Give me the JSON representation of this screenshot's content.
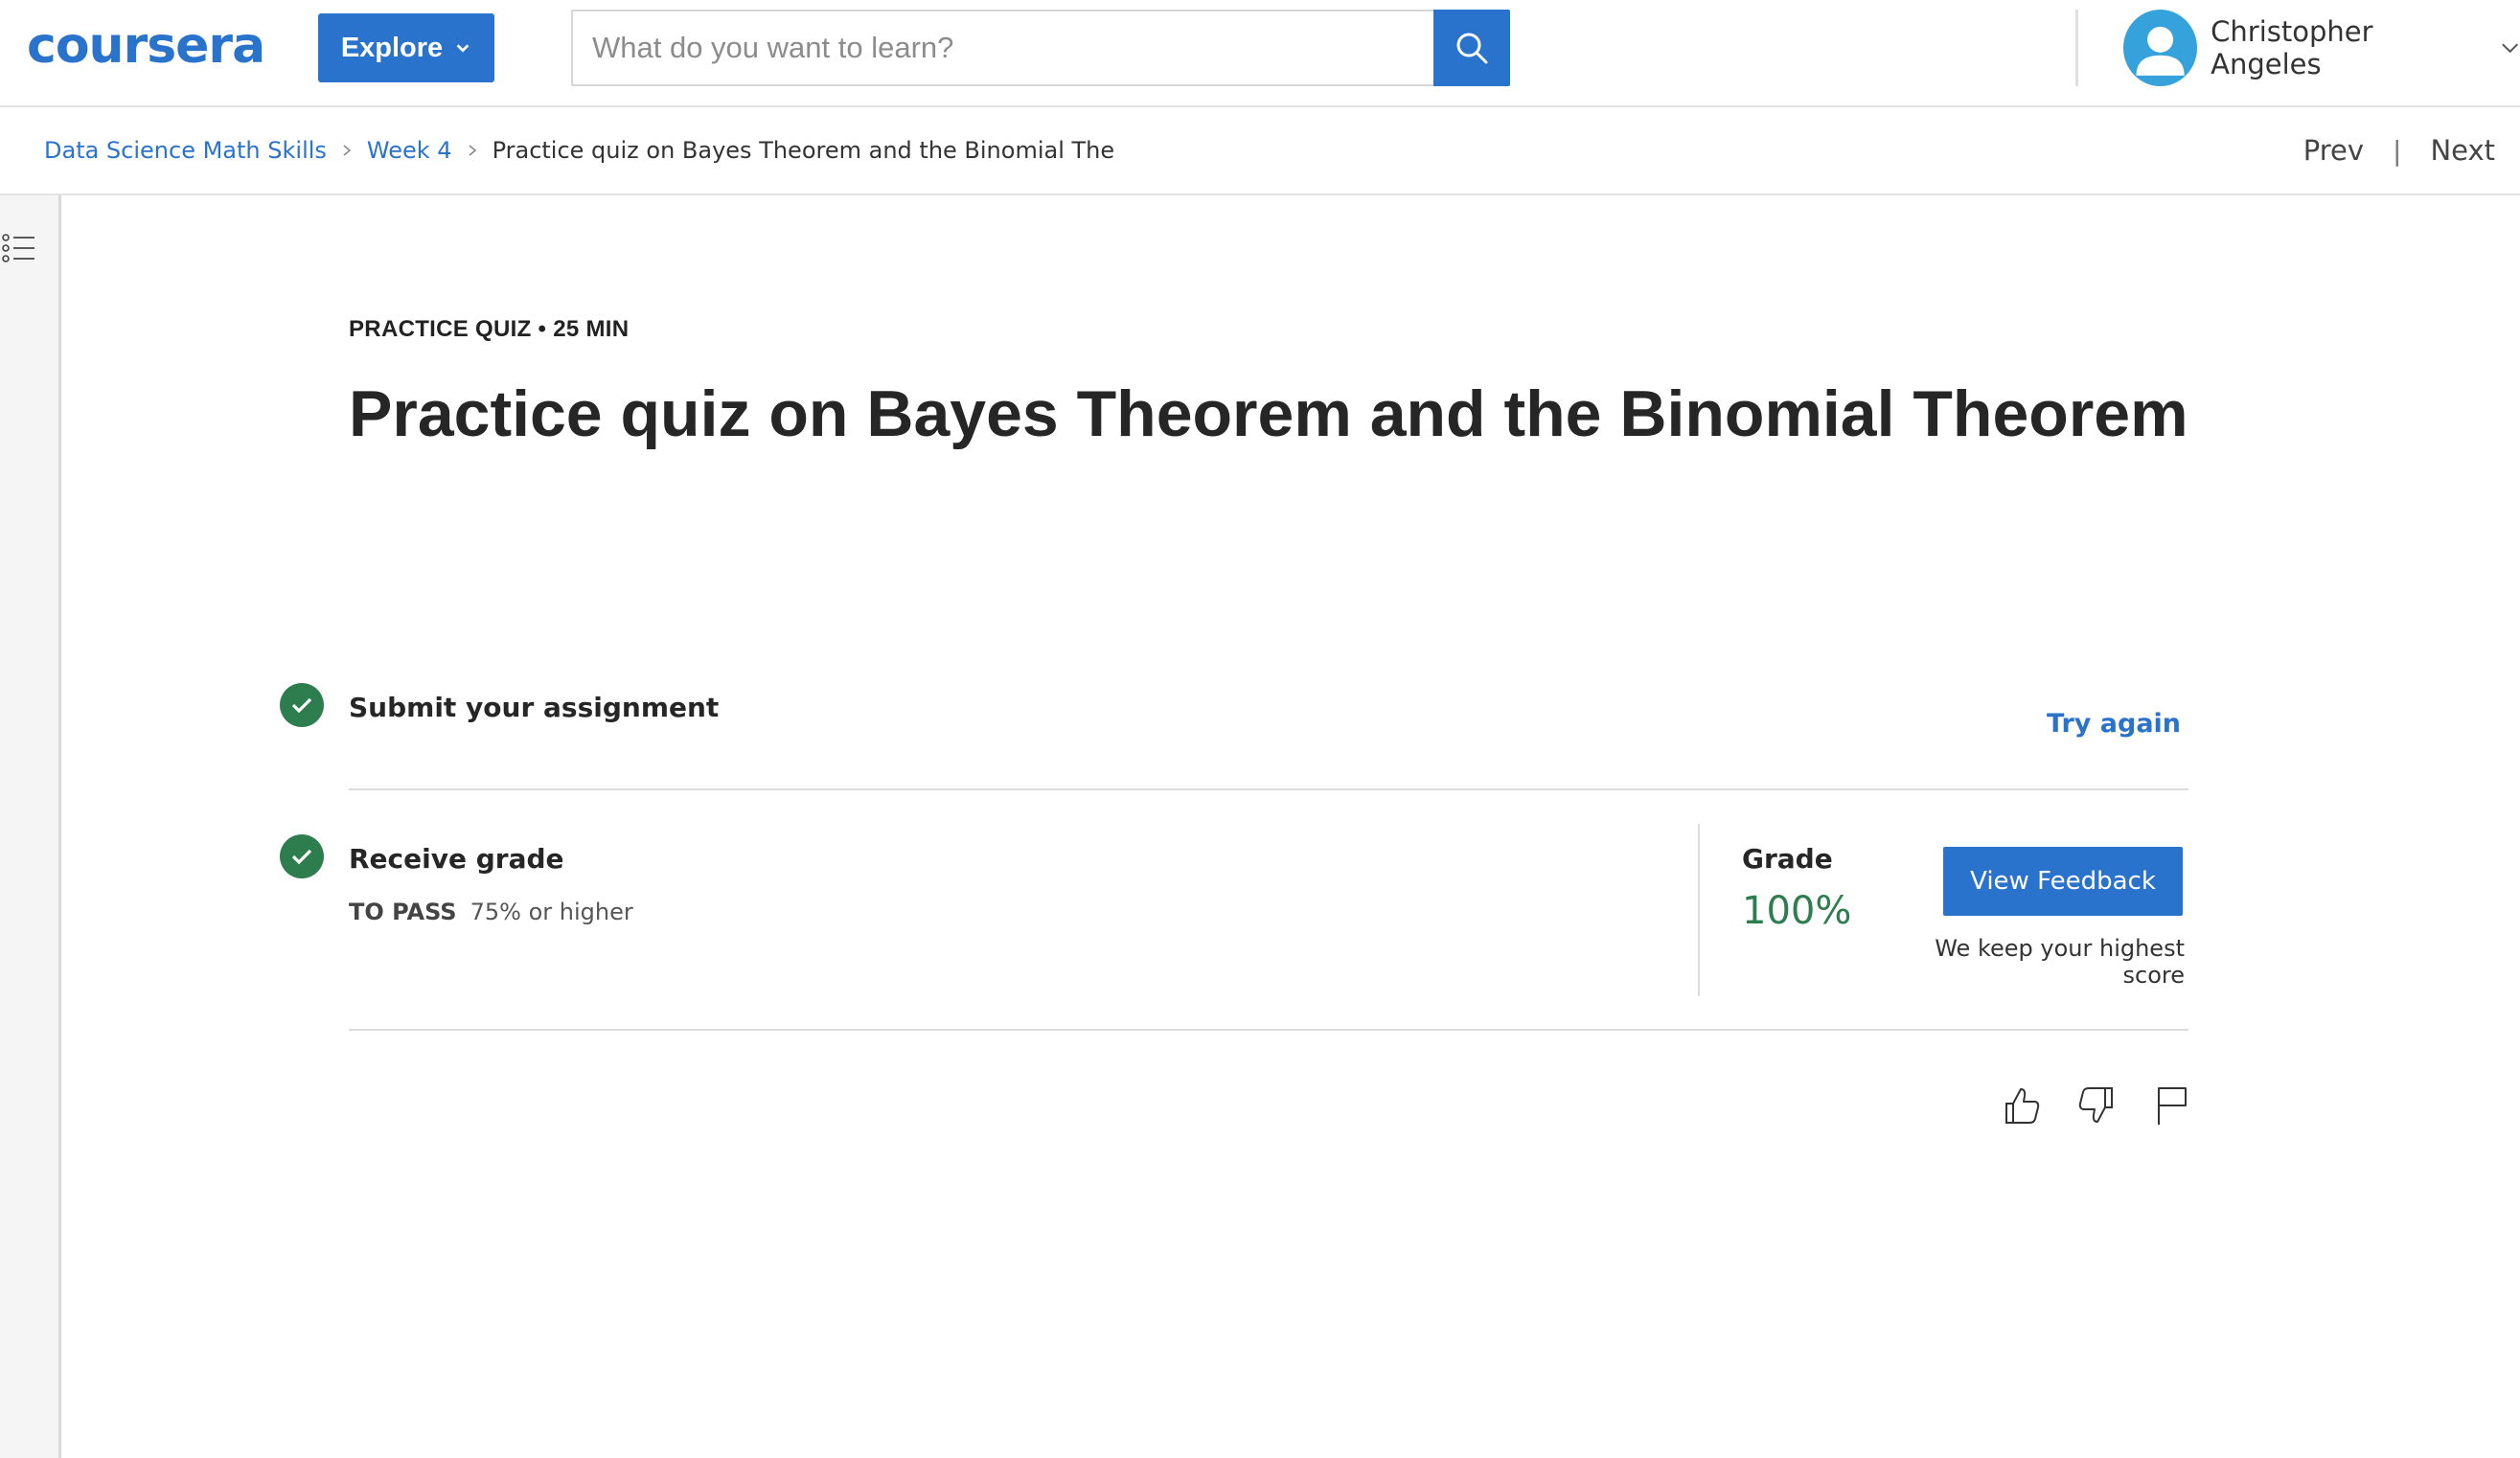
{
  "header": {
    "logo_text": "coursera",
    "explore_label": "Explore",
    "search": {
      "placeholder": "What do you want to learn?",
      "value": ""
    },
    "user_name": "Christopher Angeles"
  },
  "breadcrumb": {
    "items": [
      "Data Science Math Skills",
      "Week 4"
    ],
    "current": "Practice quiz on Bayes Theorem and the Binomial The"
  },
  "pager": {
    "prev": "Prev",
    "separator": "|",
    "next": "Next"
  },
  "quiz": {
    "meta": "PRACTICE QUIZ • 25 MIN",
    "title": "Practice quiz on Bayes Theorem and the Binomial Theorem",
    "steps": {
      "submit": {
        "title": "Submit your assignment",
        "action": "Try again"
      },
      "receive": {
        "title": "Receive grade",
        "pass_label": "TO PASS",
        "pass_value": "75% or higher",
        "grade_label": "Grade",
        "grade_value": "100%",
        "feedback_button": "View Feedback",
        "note": "We keep your highest score"
      }
    }
  },
  "colors": {
    "brand": "#2a73cc",
    "success": "#2e7d4f",
    "avatar": "#35a2db"
  },
  "icons": [
    "chevron-down-icon",
    "search-icon",
    "avatar-icon",
    "chevron-right-icon",
    "list-menu-icon",
    "check-icon",
    "thumbs-up-icon",
    "thumbs-down-icon",
    "flag-icon"
  ]
}
